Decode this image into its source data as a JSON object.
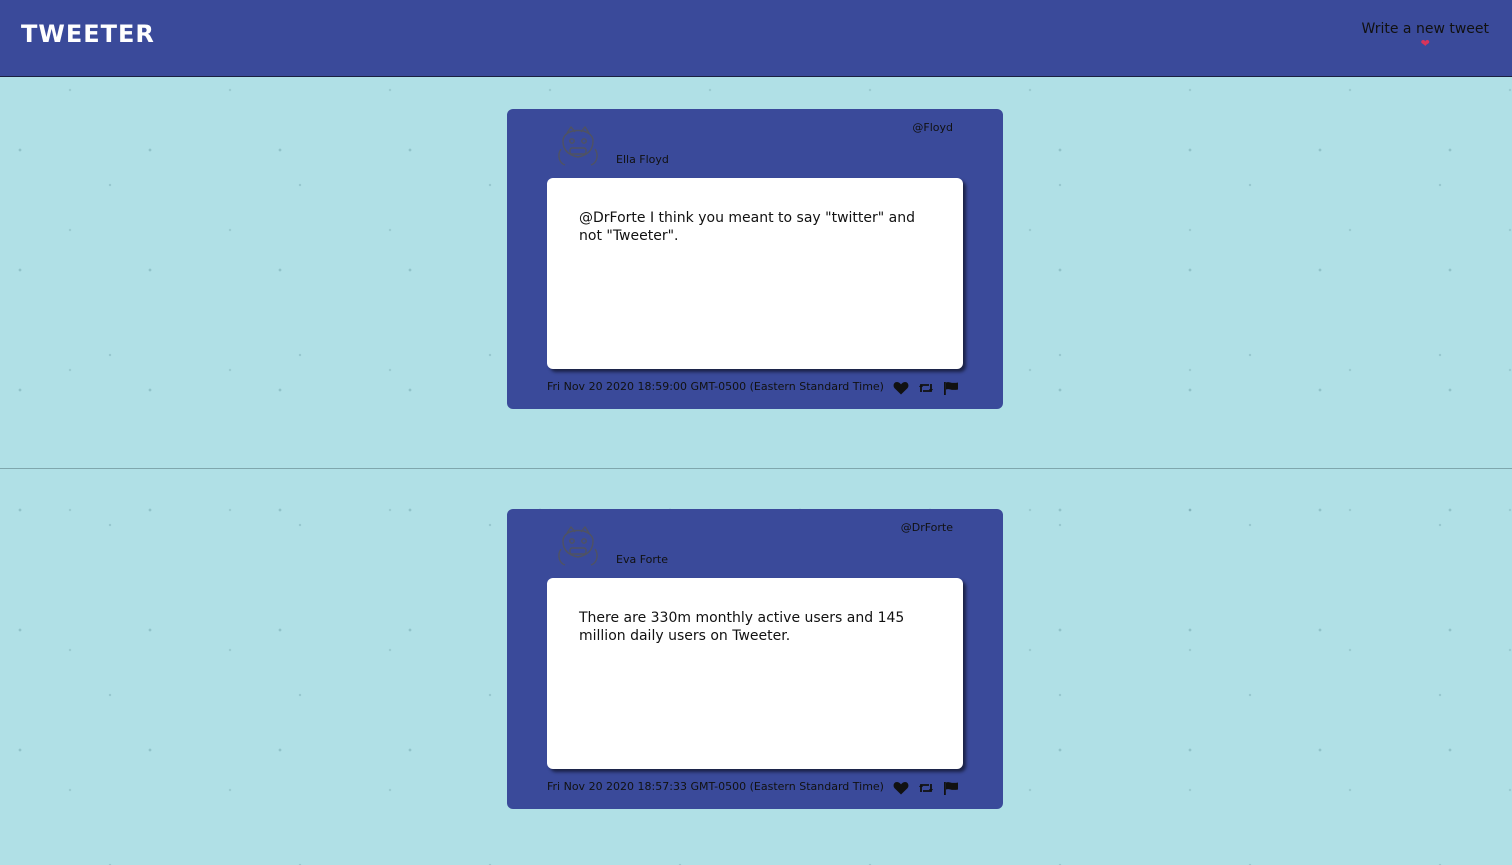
{
  "nav": {
    "logo": "TWEETER",
    "compose_label": "Write a new tweet"
  },
  "colors": {
    "background": "#b0e0e6",
    "nav": "#3a4a9a",
    "card": "#3a4a9a",
    "compose_icon": "#d8345a"
  },
  "tweets": [
    {
      "name": "Ella Floyd",
      "handle": "@Floyd",
      "content": "@DrForte I think you meant to say \"twitter\" and not \"Tweeter\".",
      "timestamp": "Fri Nov 20 2020 18:59:00 GMT-0500 (Eastern Standard Time)",
      "actions": [
        "heart-icon",
        "retweet-icon",
        "flag-icon"
      ]
    },
    {
      "name": "Eva Forte",
      "handle": "@DrForte",
      "content": "There are 330m monthly active users and 145 million daily users on Tweeter.",
      "timestamp": "Fri Nov 20 2020 18:57:33 GMT-0500 (Eastern Standard Time)",
      "actions": [
        "heart-icon",
        "retweet-icon",
        "flag-icon"
      ]
    }
  ]
}
